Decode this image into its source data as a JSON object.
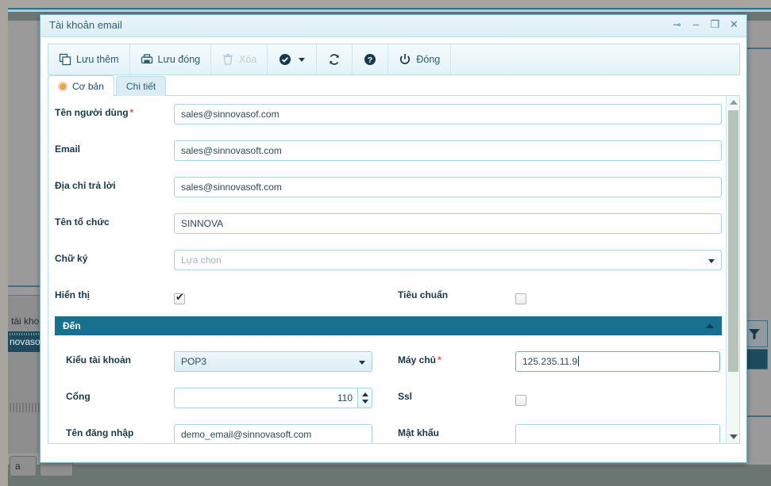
{
  "background": {
    "grid_label": "tài kho:",
    "selected_row_text": "novasof.",
    "button_a_label": "a",
    "button_b_label": "",
    "filter_icon": "funnel-icon"
  },
  "window": {
    "title": "Tài khoản email",
    "controls": [
      {
        "name": "pin-button",
        "glyph": "⊸"
      },
      {
        "name": "minimize-button",
        "glyph": "–"
      },
      {
        "name": "maximize-button",
        "glyph": "❐"
      },
      {
        "name": "close-button",
        "glyph": "✕"
      }
    ]
  },
  "toolbar": {
    "items": [
      {
        "label": "Lưu thêm",
        "icon": "copy-icon",
        "disabled": false
      },
      {
        "label": "Lưu đóng",
        "icon": "save-close-icon",
        "disabled": false
      },
      {
        "label": "Xóa",
        "icon": "trash-icon",
        "disabled": true
      },
      {
        "label": "",
        "icon": "check-circle-icon",
        "disabled": false,
        "dropdown": true
      },
      {
        "label": "",
        "icon": "refresh-icon",
        "disabled": false
      },
      {
        "label": "",
        "icon": "help-icon",
        "disabled": false
      },
      {
        "label": "Đóng",
        "icon": "power-icon",
        "disabled": false
      }
    ]
  },
  "tabs": [
    {
      "label": "Cơ bản",
      "active": true,
      "icon": "orange-dot-icon"
    },
    {
      "label": "Chi tiết",
      "active": false
    }
  ],
  "form": {
    "username": {
      "label": "Tên người dùng",
      "required": true,
      "value": "sales@sinnovasof.com"
    },
    "email": {
      "label": "Email",
      "required": false,
      "value": "sales@sinnovasoft.com"
    },
    "reply_address": {
      "label": "Địa chỉ trả lời",
      "required": false,
      "value": "sales@sinnovasoft.com"
    },
    "organization": {
      "label": "Tên tổ chức",
      "required": false,
      "value": "SINNOVA"
    },
    "signature": {
      "label": "Chữ ký",
      "required": false,
      "value": "",
      "placeholder": "Lựa chọn"
    },
    "display": {
      "label": "Hiển thị",
      "checked": true
    },
    "standard": {
      "label": "Tiêu chuẩn",
      "checked": false
    }
  },
  "incoming_section": {
    "title": "Đến",
    "account_type": {
      "label": "Kiểu tài khoản",
      "required": false,
      "value": "POP3"
    },
    "server": {
      "label": "Máy chủ",
      "required": true,
      "value": "125.235.11.9",
      "focused": true
    },
    "port": {
      "label": "Cổng",
      "required": false,
      "value": "110"
    },
    "ssl": {
      "label": "Ssl",
      "checked": false
    },
    "login_name": {
      "label": "Tên đăng nhập",
      "required": false,
      "value": "demo_email@sinnovasoft.com"
    },
    "password": {
      "label": "Mật khẩu",
      "required": false,
      "value": ""
    }
  },
  "colors": {
    "accent_teal": "#18708f",
    "titlebar": "#e9f5fa",
    "border_blue": "#b7dcea",
    "required_red": "#e2574c",
    "tab_dot_orange": "#ef7f16"
  }
}
